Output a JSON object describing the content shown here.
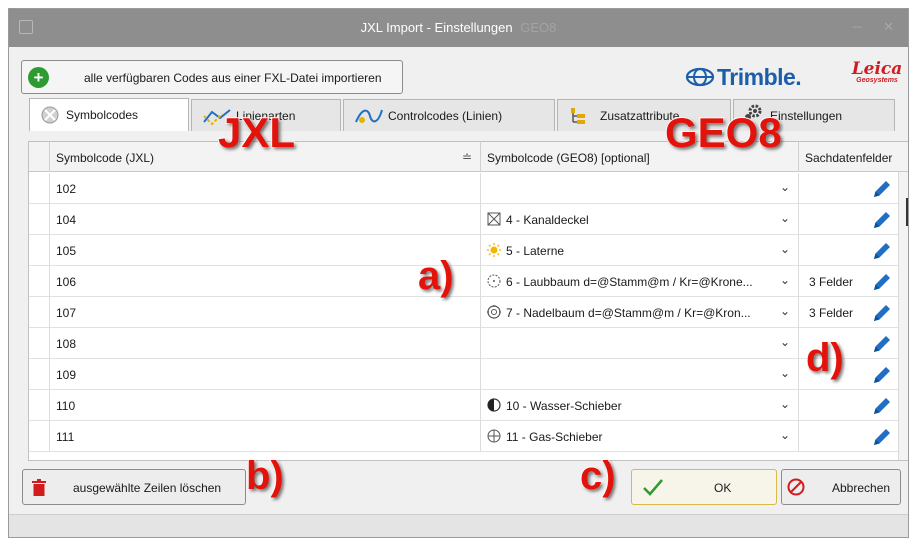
{
  "window": {
    "title": "JXL Import - Einstellungen",
    "title_faint": "GEO8"
  },
  "toolbar": {
    "import_label": "alle verfügbaren Codes aus einer FXL-Datei importieren"
  },
  "logos": {
    "trimble": "Trimble.",
    "leica": "Leica",
    "leica_sub": "Geosystems"
  },
  "tabs": [
    {
      "label": "Symbolcodes",
      "active": true,
      "icon": "symbol-icon"
    },
    {
      "label": "Linienarten",
      "active": false,
      "icon": "line-type-icon"
    },
    {
      "label": "Controlcodes (Linien)",
      "active": false,
      "icon": "control-code-icon"
    },
    {
      "label": "Zusatzattribute",
      "active": false,
      "icon": "attribute-icon"
    },
    {
      "label": "Einstellungen",
      "active": false,
      "icon": "gear-icon"
    }
  ],
  "grid": {
    "columns": [
      "Symbolcode (JXL)",
      "Symbolcode (GEO8) [optional]",
      "Sachdatenfelder"
    ],
    "sort_glyph": "≐",
    "rows": [
      {
        "code": "102",
        "symbol": "",
        "symbol_icon": "",
        "attributes": ""
      },
      {
        "code": "104",
        "symbol": "4 - Kanaldeckel",
        "symbol_icon": "manhole-icon",
        "attributes": ""
      },
      {
        "code": "105",
        "symbol": "5 - Laterne",
        "symbol_icon": "lamp-icon",
        "attributes": ""
      },
      {
        "code": "106",
        "symbol": "6 - Laubbaum d=@Stamm@m / Kr=@Krone...",
        "symbol_icon": "tree-icon",
        "attributes": "3 Felder"
      },
      {
        "code": "107",
        "symbol": "7 - Nadelbaum  d=@Stamm@m / Kr=@Kron...",
        "symbol_icon": "conifer-icon",
        "attributes": "3 Felder"
      },
      {
        "code": "108",
        "symbol": "",
        "symbol_icon": "",
        "attributes": ""
      },
      {
        "code": "109",
        "symbol": "",
        "symbol_icon": "",
        "attributes": ""
      },
      {
        "code": "110",
        "symbol": "10 - Wasser-Schieber",
        "symbol_icon": "water-valve-icon",
        "attributes": ""
      },
      {
        "code": "111",
        "symbol": "11 - Gas-Schieber",
        "symbol_icon": "gas-valve-icon",
        "attributes": ""
      }
    ]
  },
  "buttons": {
    "delete_label": "ausgewählte Zeilen löschen",
    "ok_label": "OK",
    "cancel_label": "Abbrechen"
  },
  "annotations": {
    "jxl": "JXL",
    "geo8": "GEO8",
    "a": "a)",
    "b": "b)",
    "c": "c)",
    "d": "d)"
  },
  "colors": {
    "accent_blue": "#1f6fc4",
    "annotation_red": "#e3120b",
    "ok_border": "#d8b94a",
    "title_bar": "#8e8e8e"
  }
}
